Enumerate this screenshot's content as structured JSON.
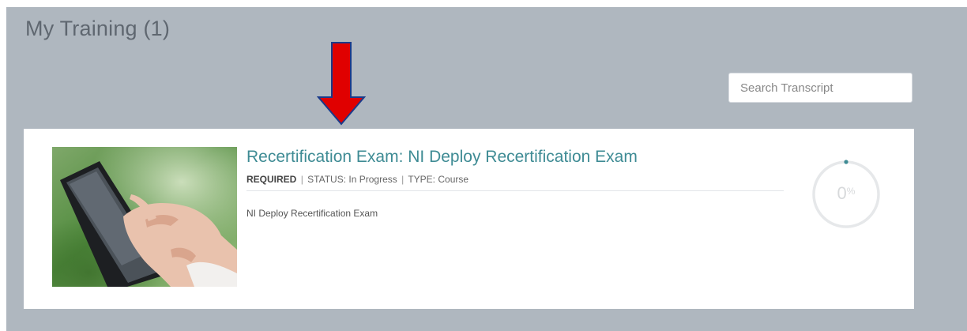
{
  "page": {
    "title": "My Training (1)"
  },
  "search": {
    "placeholder": "Search Transcript"
  },
  "course": {
    "title": "Recertification Exam: NI Deploy Recertification Exam",
    "required_label": "REQUIRED",
    "status_text": "STATUS: In Progress",
    "type_text": "TYPE: Course",
    "separator": "|",
    "description": "NI Deploy Recertification Exam",
    "progress_value": "0",
    "progress_unit": "%",
    "progress_fraction": 0,
    "thumbnail_icon": "hand-tablet-photo"
  },
  "colors": {
    "panel_bg": "#afb7bf",
    "accent": "#3e8b94",
    "arrow": "#e00000"
  }
}
